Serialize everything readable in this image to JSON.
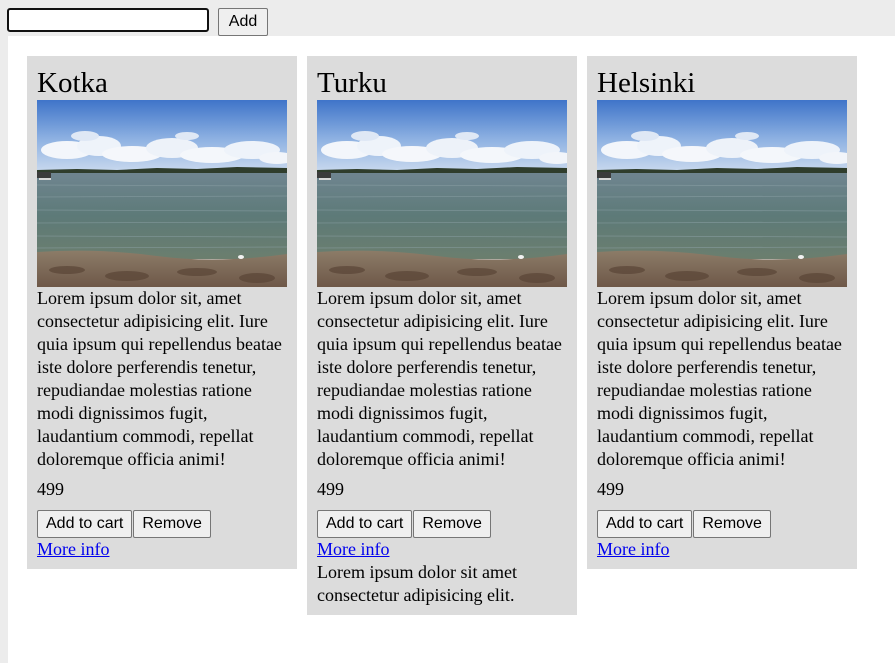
{
  "toolbar": {
    "input_value": "",
    "input_placeholder": "",
    "add_label": "Add"
  },
  "cards": [
    {
      "title": "Kotka",
      "description": "Lorem ipsum dolor sit, amet consectetur adipisicing elit. Iure quia ipsum qui repellendus beatae iste dolore perferendis tenetur, repudiandae molestias ratione modi dignissimos fugit, laudantium commodi, repellat doloremque officia animi!",
      "price": "499",
      "add_to_cart_label": "Add to cart",
      "remove_label": "Remove",
      "more_info_label": "More info",
      "extra": ""
    },
    {
      "title": "Turku",
      "description": "Lorem ipsum dolor sit, amet consectetur adipisicing elit. Iure quia ipsum qui repellendus beatae iste dolore perferendis tenetur, repudiandae molestias ratione modi dignissimos fugit, laudantium commodi, repellat doloremque officia animi!",
      "price": "499",
      "add_to_cart_label": "Add to cart",
      "remove_label": "Remove",
      "more_info_label": "More info",
      "extra": "Lorem ipsum dolor sit amet consectetur adipisicing elit."
    },
    {
      "title": "Helsinki",
      "description": "Lorem ipsum dolor sit, amet consectetur adipisicing elit. Iure quia ipsum qui repellendus beatae iste dolore perferendis tenetur, repudiandae molestias ratione modi dignissimos fugit, laudantium commodi, repellat doloremque officia animi!",
      "price": "499",
      "add_to_cart_label": "Add to cart",
      "remove_label": "Remove",
      "more_info_label": "More info",
      "extra": ""
    }
  ],
  "colors": {
    "card_background": "#dcdcdc",
    "link": "#0000ee",
    "page_background": "#ffffff",
    "topbar_background": "#ececec"
  }
}
